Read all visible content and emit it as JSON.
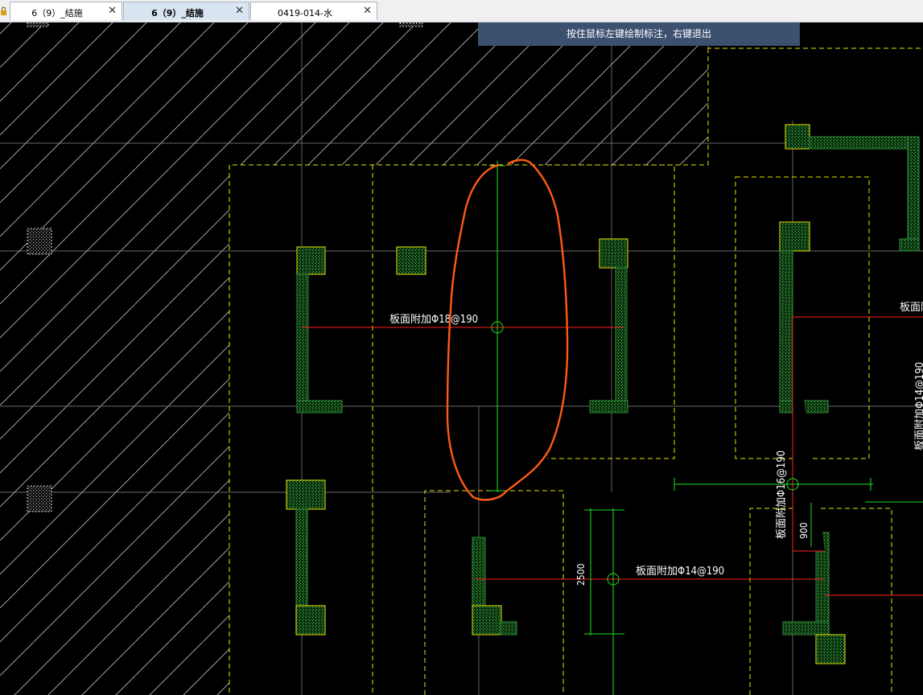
{
  "tabs": [
    {
      "label": "6（9）_结施",
      "active": false
    },
    {
      "label": "6（9）_结施",
      "active": true
    },
    {
      "label": "0419-014-水",
      "active": false
    }
  ],
  "hint_banner": "按住鼠标左键绘制标注，右键退出",
  "annotations": {
    "a1": "板面附加Φ18@190",
    "a2": "板面附加Φ14@190",
    "a3": "板面附加Φ16@190",
    "a4": "板面附",
    "a5": "板面附加Φ14@190",
    "dim1": "2500",
    "dim2": "900"
  },
  "colors": {
    "background": "#000000",
    "hatch": "#cccccc",
    "dashed_outline": "#e6e600",
    "rebar_red": "#ff2020",
    "dim_green": "#20e020",
    "markup_orange": "#ff5a14",
    "column_green": "#1f8f2a"
  }
}
